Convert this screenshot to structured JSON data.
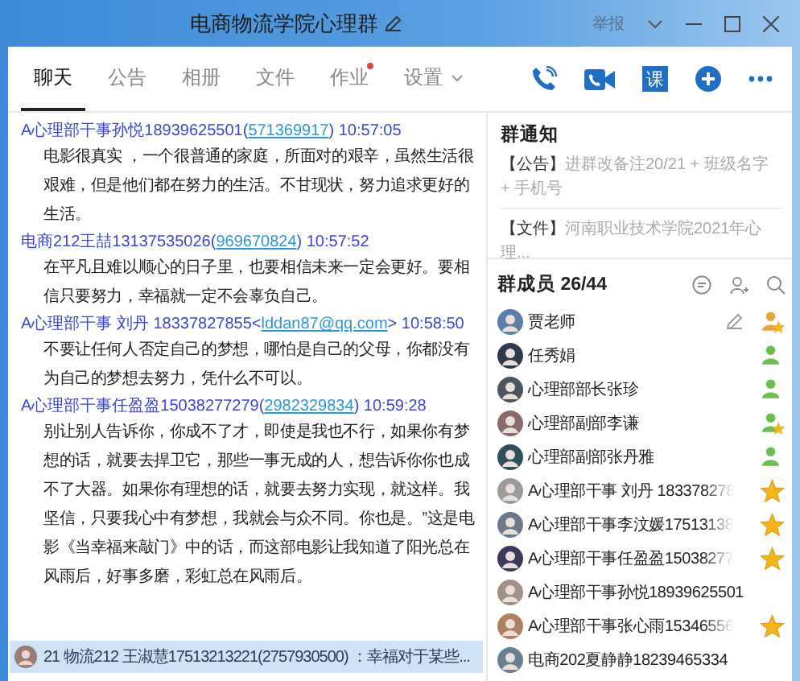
{
  "window": {
    "title": "电商物流学院心理群",
    "report": "举报"
  },
  "tabs": [
    {
      "label": "聊天",
      "selected": true,
      "dot": false,
      "dropdown": false
    },
    {
      "label": "公告",
      "selected": false,
      "dot": false,
      "dropdown": false
    },
    {
      "label": "相册",
      "selected": false,
      "dot": false,
      "dropdown": false
    },
    {
      "label": "文件",
      "selected": false,
      "dot": false,
      "dropdown": false
    },
    {
      "label": "作业",
      "selected": false,
      "dot": true,
      "dropdown": false
    },
    {
      "label": "设置",
      "selected": false,
      "dot": false,
      "dropdown": true
    }
  ],
  "toolbar": {
    "course_label": "课"
  },
  "messages": [
    {
      "sender": "A心理部干事孙悦18939625501(",
      "link": "571369917",
      "link_end": ")",
      "time": "10:57:05",
      "text": "电影很真实 ，一个很普通的家庭，所面对的艰辛，虽然生活很艰难，但是他们都在努力的生活。不甘现状，努力追求更好的生活。"
    },
    {
      "sender": "电商212王喆13137535026(",
      "link": "969670824",
      "link_end": ")",
      "time": "10:57:52",
      "text": "在平凡且难以顺心的日子里，也要相信未来一定会更好。要相信只要努力，幸福就一定不会辜负自己。"
    },
    {
      "sender": " A心理部干事  刘丹 18337827855<",
      "link": "lddan87@qq.com",
      "link_end": ">",
      "time": "10:58:50",
      "text": "不要让任何人否定自己的梦想，哪怕是自己的父母，你都没有为自己的梦想去努力，凭什么不可以。"
    },
    {
      "sender": "A心理部干事任盈盈15038277279(",
      "link": "2982329834",
      "link_end": ")",
      "time": "10:59:28",
      "text": "别让别人告诉你，你成不了才，即使是我也不行，如果你有梦想的话，就要去捍卫它，那些一事无成的人，想告诉你你也成不了大器。如果你有理想的话，就要去努力实现，就这样。我坚信，只要我心中有梦想，我就会与众不同。你也是。”这是电影《当幸福来敲门》中的话，而这部电影让我知道了阳光总在风雨后，好事多磨，彩虹总在风雨后。"
    }
  ],
  "ticker": {
    "text": "21 物流212 王淑慧17513213221(2757930500) ：幸福对于某些..."
  },
  "notice": {
    "title": "群通知",
    "items": [
      {
        "tag": "【公告】",
        "text": "进群改备注20/21 + 班级名字 + 手机号"
      },
      {
        "tag": "【文件】",
        "text": "河南职业技术学院2021年心理..."
      }
    ]
  },
  "members": {
    "title": "群成员 26/44",
    "items": [
      {
        "name": "贾老师",
        "kind": "owner",
        "editable": true,
        "fade": false
      },
      {
        "name": "任秀娟",
        "kind": "admin",
        "editable": false,
        "fade": false
      },
      {
        "name": "心理部部长张珍",
        "kind": "admin",
        "editable": false,
        "fade": false
      },
      {
        "name": "心理部副部李谦",
        "kind": "admin_star",
        "editable": false,
        "fade": false
      },
      {
        "name": "心理部副部张丹雅",
        "kind": "admin",
        "editable": false,
        "fade": false
      },
      {
        "name": "A心理部干事  刘丹 183378278",
        "kind": "star",
        "editable": false,
        "fade": true
      },
      {
        "name": "A心理部干事李汶媛17513138",
        "kind": "star",
        "editable": false,
        "fade": true
      },
      {
        "name": "A心理部干事任盈盈15038277",
        "kind": "star",
        "editable": false,
        "fade": true
      },
      {
        "name": "A心理部干事孙悦18939625501",
        "kind": "member",
        "editable": false,
        "fade": false
      },
      {
        "name": "A心理部干事张心雨15346556",
        "kind": "star",
        "editable": false,
        "fade": true
      },
      {
        "name": "电商202夏静静18239465334",
        "kind": "member",
        "editable": false,
        "fade": false
      }
    ]
  }
}
